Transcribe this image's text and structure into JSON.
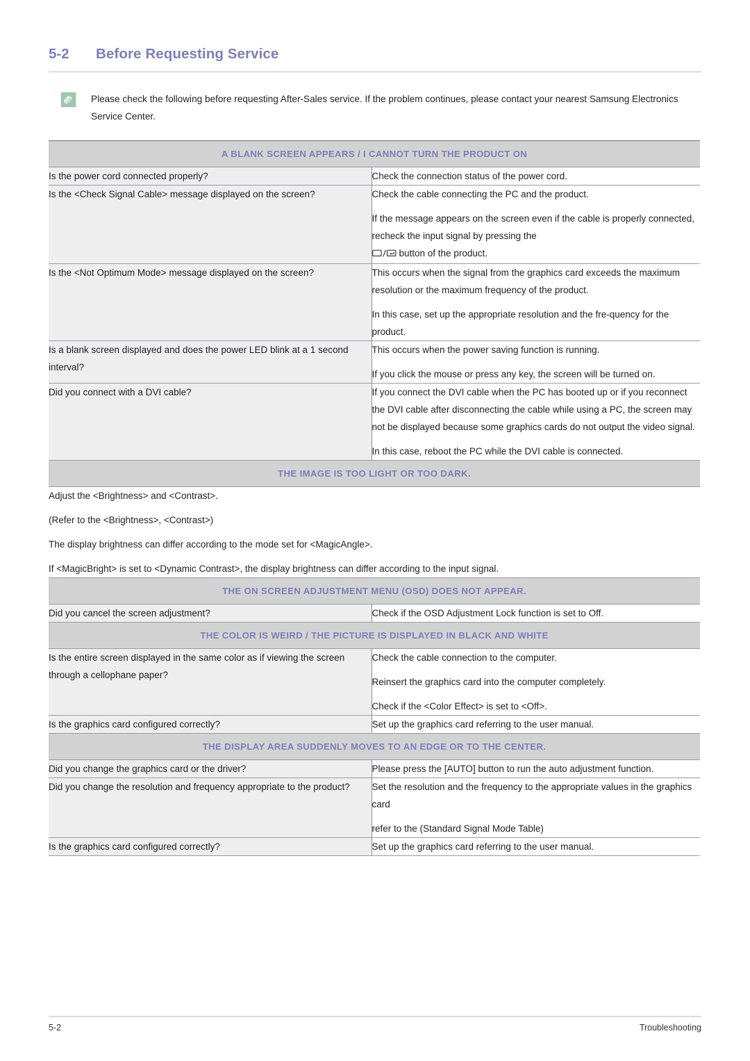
{
  "page": {
    "section_number": "5-2",
    "title": "Before Requesting Service",
    "footer_left": "5-2",
    "footer_right": "Troubleshooting"
  },
  "note": {
    "icon": "note-paperclip-icon",
    "text": "Please check the following before requesting After-Sales service. If the problem continues, please contact your nearest Samsung Electronics Service Center."
  },
  "sections": [
    {
      "heading": "A BLANK SCREEN APPEARS / I CANNOT TURN THE PRODUCT ON",
      "rows": [
        {
          "question": "Is the power cord connected properly?",
          "answers": [
            "Check the connection status of the power cord."
          ]
        },
        {
          "question": "Is the <Check Signal Cable> message displayed on the screen?",
          "answers": [
            "Check the cable connecting the PC and the product.",
            "If the message appears on the screen even if the cable is properly connected, recheck the input signal by pressing the",
            "button of the product."
          ],
          "glyph_line": true
        },
        {
          "question": "Is the <Not Optimum Mode> message displayed on the screen?",
          "answers": [
            "This occurs when the signal from the graphics card exceeds the maximum resolution or the maximum frequency of the product.",
            "In this case, set up the appropriate resolution and the fre-quency for the product."
          ]
        },
        {
          "question": "Is a blank screen displayed and does the power LED blink at a 1 second interval?",
          "answers": [
            "This occurs when the power saving function is running.",
            "If you click the mouse or press any key, the screen will be turned on."
          ]
        },
        {
          "question": "Did you connect with a DVI cable?",
          "answers": [
            "If you connect the DVI cable when the PC has booted up or if you reconnect the DVI cable after disconnecting the cable while using a PC, the screen may not be displayed because some graphics cards do not output the video signal.",
            "In this case, reboot the PC while the DVI cable is connected."
          ]
        }
      ]
    },
    {
      "heading": "THE IMAGE IS TOO LIGHT OR TOO DARK.",
      "full_width_paragraphs": [
        "Adjust the <Brightness> and <Contrast>.",
        "(Refer to the <Brightness>, <Contrast>)",
        "The display brightness can differ according to the mode set for <MagicAngle>.",
        "If <MagicBright> is set to <Dynamic Contrast>, the display brightness can differ according to the input signal."
      ]
    },
    {
      "heading": "THE ON SCREEN ADJUSTMENT MENU (OSD) DOES NOT APPEAR.",
      "rows": [
        {
          "question": "Did you cancel the screen adjustment?",
          "answers": [
            "Check if the OSD Adjustment Lock function is set to Off."
          ]
        }
      ]
    },
    {
      "heading": "THE COLOR IS WEIRD / THE PICTURE IS DISPLAYED IN BLACK AND WHITE",
      "rows": [
        {
          "question": "Is the entire screen displayed in the same color as if viewing the screen through a cellophane paper?",
          "answers": [
            "Check the cable connection to the computer.",
            "Reinsert the graphics card into the computer completely.",
            "Check if the <Color Effect> is set to <Off>."
          ]
        },
        {
          "question": "Is the graphics card configured correctly?",
          "answers": [
            "Set up the graphics card referring to the user manual."
          ]
        }
      ]
    },
    {
      "heading": "THE DISPLAY AREA SUDDENLY MOVES TO AN EDGE OR TO THE CENTER.",
      "rows": [
        {
          "question": "Did you change the graphics card or the driver?",
          "answers": [
            "Please press the [AUTO] button to run the auto adjustment function."
          ]
        },
        {
          "question": "Did you change the resolution and frequency appropriate to the product?",
          "answers": [
            "Set the resolution and the frequency to the appropriate values in the graphics card",
            "refer to the (Standard Signal Mode Table)"
          ]
        },
        {
          "question": "Is the graphics card configured correctly?",
          "answers": [
            "Set up the graphics card referring to the user manual."
          ]
        }
      ]
    }
  ],
  "colors": {
    "accent_purple": "#7b7fbb",
    "section_band": "#d2d2d2",
    "question_cell": "#eeeeee",
    "note_icon": "#9ec9ae"
  }
}
